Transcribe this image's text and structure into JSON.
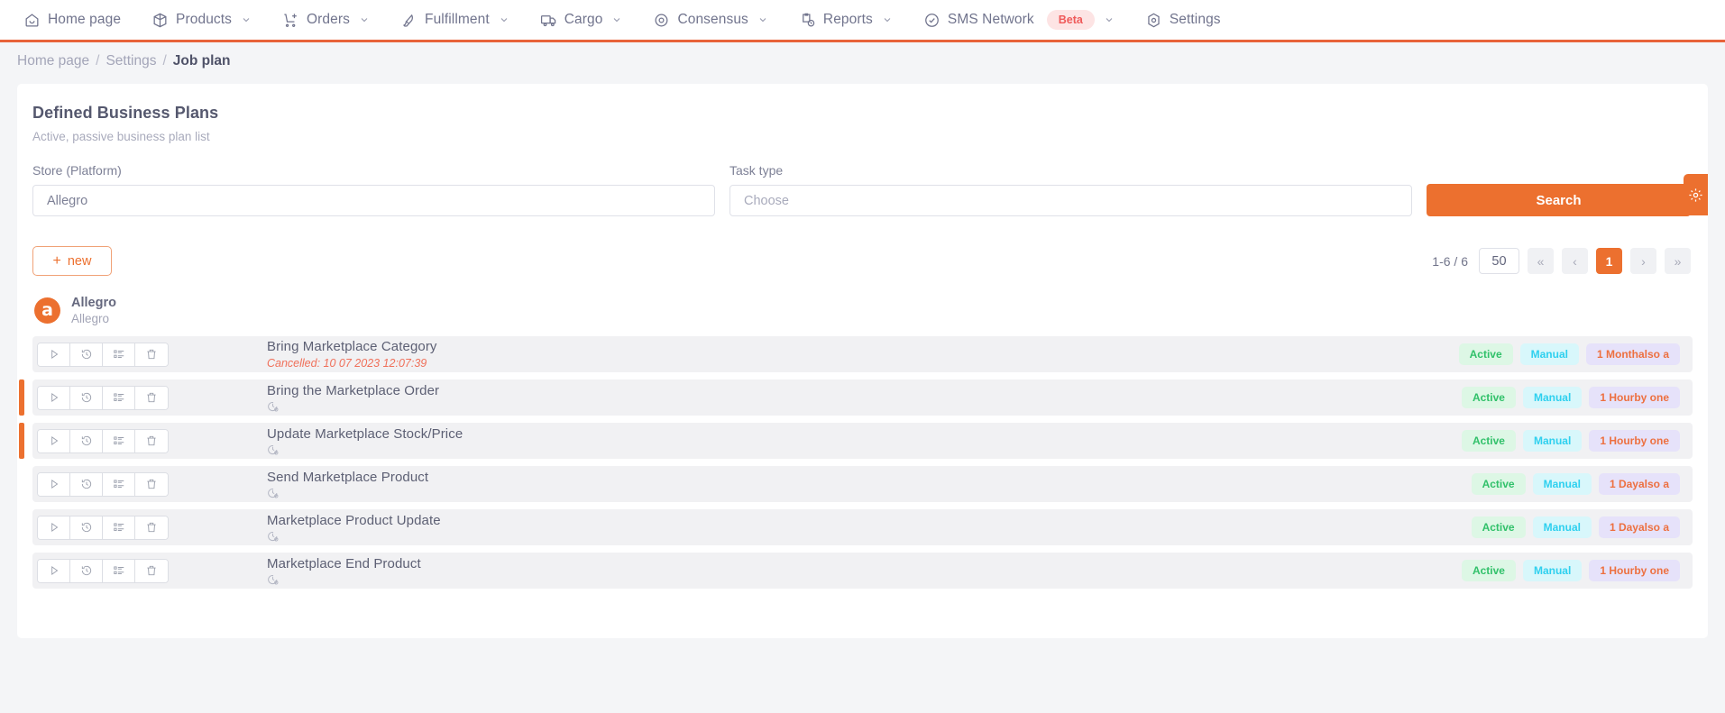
{
  "navbar": {
    "items": [
      {
        "label": "Home page",
        "icon": "home-icon",
        "caret": false,
        "badge": null
      },
      {
        "label": "Products",
        "icon": "box-icon",
        "caret": true,
        "badge": null
      },
      {
        "label": "Orders",
        "icon": "cart-plus-icon",
        "caret": true,
        "badge": null
      },
      {
        "label": "Fulfillment",
        "icon": "rocket-icon",
        "caret": true,
        "badge": null
      },
      {
        "label": "Cargo",
        "icon": "truck-icon",
        "caret": true,
        "badge": null
      },
      {
        "label": "Consensus",
        "icon": "target-icon",
        "caret": true,
        "badge": null
      },
      {
        "label": "Reports",
        "icon": "clipboard-clock-icon",
        "caret": true,
        "badge": null
      },
      {
        "label": "SMS Network",
        "icon": "check-circle-icon",
        "caret": true,
        "badge": "Beta"
      },
      {
        "label": "Settings",
        "icon": "gear-hex-icon",
        "caret": false,
        "badge": null
      }
    ]
  },
  "breadcrumb": {
    "items": [
      "Home page",
      "Settings",
      "Job plan"
    ],
    "separator": "/"
  },
  "panel": {
    "title": "Defined Business Plans",
    "subtitle": "Active, passive business plan list"
  },
  "filters": {
    "store_label": "Store (Platform)",
    "store_value": "Allegro",
    "task_label": "Task type",
    "task_placeholder": "Choose",
    "search_label": "Search"
  },
  "toolbar": {
    "new_label": "new",
    "new_plus": "+",
    "range_text": "1-6 / 6",
    "page_size": "50",
    "first_glyph": "«",
    "prev_glyph": "‹",
    "current_page": "1",
    "next_glyph": "›",
    "last_glyph": "»"
  },
  "platform": {
    "logo_letter": "a",
    "name": "Allegro",
    "sub": "Allegro"
  },
  "actions": {
    "run": "play-icon",
    "history": "history-icon",
    "logs": "list-icon",
    "delete": "trash-icon"
  },
  "rows": [
    {
      "title": "Bring Marketplace Category",
      "meta": "Cancelled: 10 07 2023 12:07:39",
      "has_clock": false,
      "accent": false,
      "badges": [
        "Active",
        "Manual",
        "1 Monthalso a"
      ]
    },
    {
      "title": "Bring the Marketplace Order",
      "meta": null,
      "has_clock": true,
      "accent": true,
      "badges": [
        "Active",
        "Manual",
        "1 Hourby one"
      ]
    },
    {
      "title": "Update Marketplace Stock/Price",
      "meta": null,
      "has_clock": true,
      "accent": true,
      "badges": [
        "Active",
        "Manual",
        "1 Hourby one"
      ]
    },
    {
      "title": "Send Marketplace Product",
      "meta": null,
      "has_clock": true,
      "accent": false,
      "badges": [
        "Active",
        "Manual",
        "1 Dayalso a"
      ]
    },
    {
      "title": "Marketplace Product Update",
      "meta": null,
      "has_clock": true,
      "accent": false,
      "badges": [
        "Active",
        "Manual",
        "1 Dayalso a"
      ]
    },
    {
      "title": "Marketplace End Product",
      "meta": null,
      "has_clock": true,
      "accent": false,
      "badges": [
        "Active",
        "Manual",
        "1 Hourby one"
      ]
    }
  ],
  "side_tab": {
    "icon": "gear-icon"
  },
  "colors": {
    "accent": "#ec702f",
    "active_badge": "#31c16a",
    "manual_badge": "#2ed0ef",
    "interval_badge": "#ed7040",
    "cancelled_text": "#f0705a",
    "beta_badge": "#ef5a5a"
  }
}
